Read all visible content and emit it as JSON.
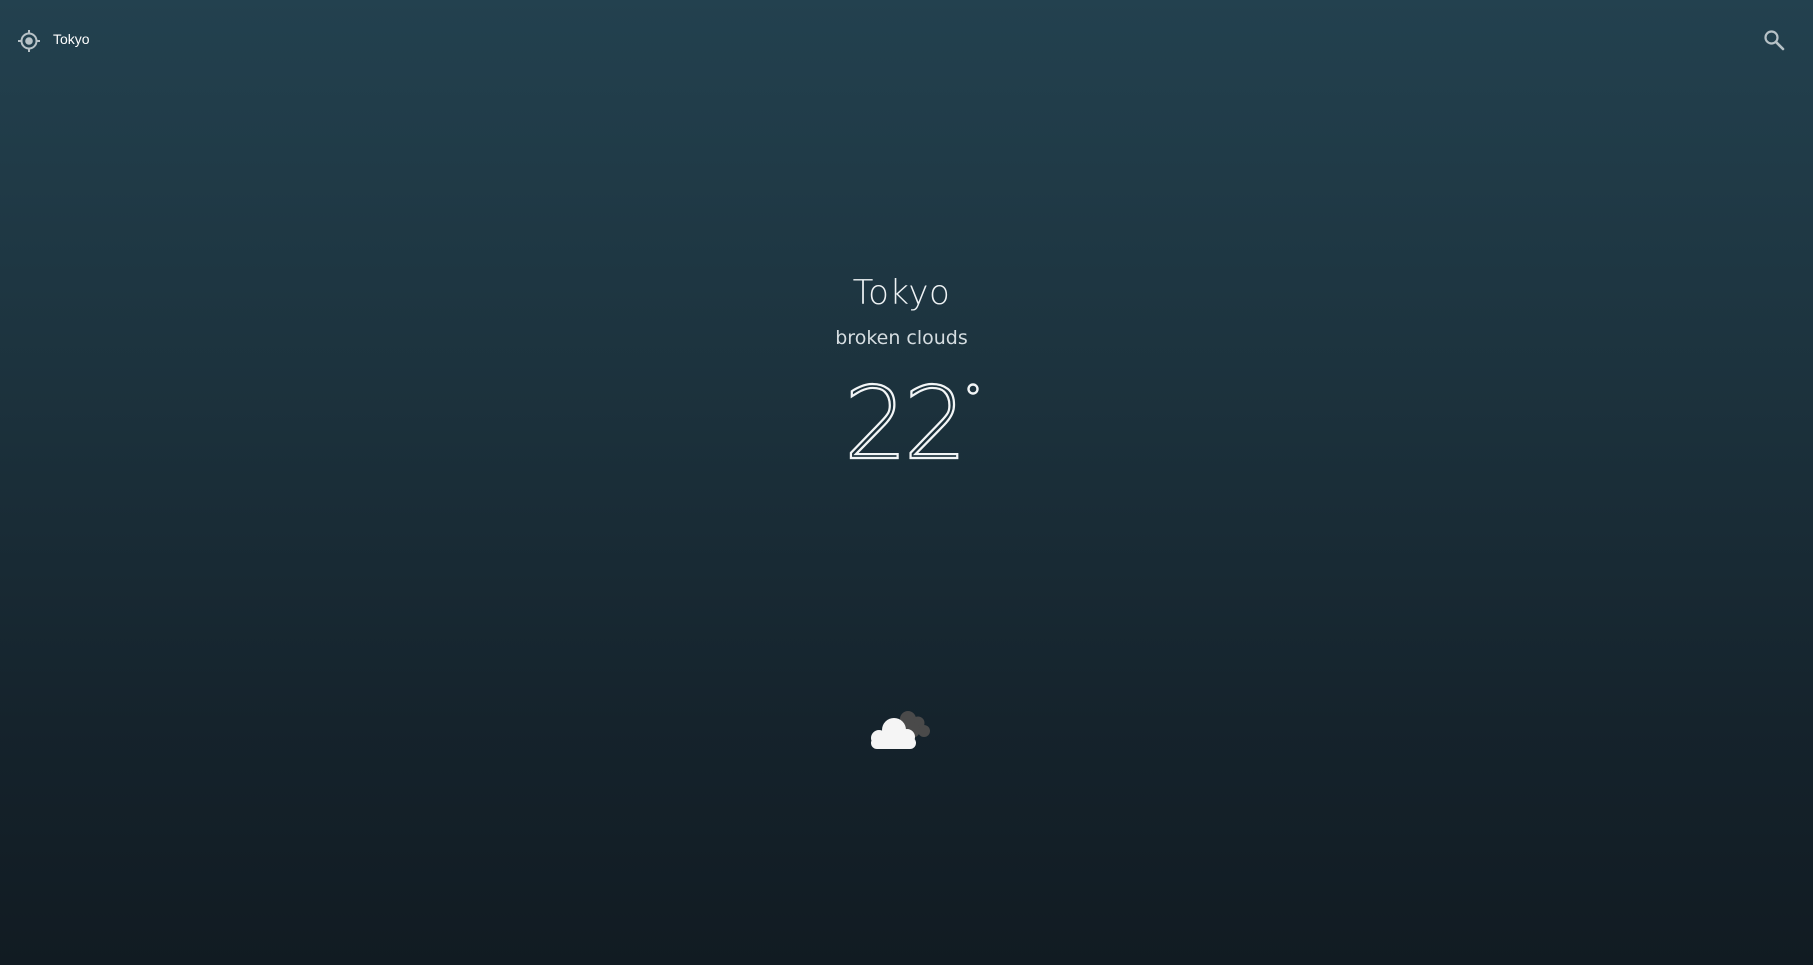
{
  "search": {
    "value": "Tokyo",
    "locate_icon": "crosshair-locate-icon",
    "search_icon": "search-icon"
  },
  "weather": {
    "city": "Tokyo",
    "description": "broken clouds",
    "temperature": "22",
    "degree_symbol": "°",
    "condition_icon": "broken-clouds-icon"
  },
  "colors": {
    "background_top": "#23414f",
    "background_bottom": "#111b22",
    "text": "#e8ecee",
    "cloud_front": "#f5f5f5",
    "cloud_back": "#4a4a4a"
  }
}
